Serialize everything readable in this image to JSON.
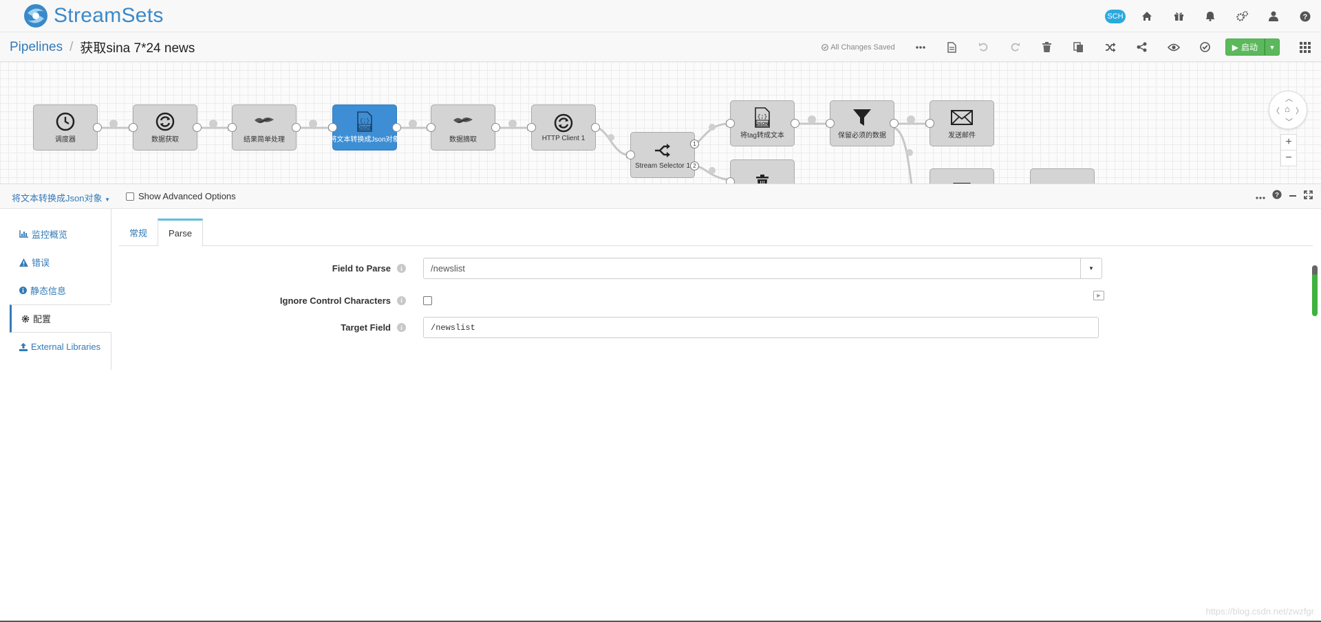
{
  "app": {
    "brand": "StreamSets",
    "sch_badge": "SCH"
  },
  "breadcrumb": {
    "root": "Pipelines",
    "separator": "/",
    "pipeline_name": "获取sina 7*24 news"
  },
  "toolbar": {
    "saved_status": "All Changes Saved",
    "start_label": "启动"
  },
  "pipeline": {
    "nodes": [
      {
        "id": "n1",
        "label": "调度器",
        "icon": "clock-icon"
      },
      {
        "id": "n2",
        "label": "数据获取",
        "icon": "refresh-icon"
      },
      {
        "id": "n3",
        "label": "结果简单处理",
        "icon": "groovy-icon"
      },
      {
        "id": "n4",
        "label": "将文本转换成Json对象",
        "icon": "json-icon",
        "selected": true
      },
      {
        "id": "n5",
        "label": "数据摘取",
        "icon": "groovy-icon"
      },
      {
        "id": "n6",
        "label": "HTTP Client 1",
        "icon": "refresh-icon"
      },
      {
        "id": "n7",
        "label": "Stream Selector 1",
        "icon": "shuffle-icon"
      },
      {
        "id": "n8",
        "label": "将tag转成文本",
        "icon": "json-icon"
      },
      {
        "id": "n9",
        "label": "保留必须的数据",
        "icon": "funnel-icon"
      },
      {
        "id": "n10",
        "label": "发送邮件",
        "icon": "envelope-icon"
      },
      {
        "id": "n11",
        "label": "",
        "icon": "trash-icon"
      },
      {
        "id": "n12",
        "label": "",
        "icon": "funnel-icon"
      },
      {
        "id": "n13",
        "label": "",
        "icon": "users-icon"
      }
    ],
    "output_ports": [
      "1",
      "2"
    ]
  },
  "detail": {
    "stage_name": "将文本转换成Json对象",
    "show_advanced_label": "Show Advanced Options",
    "nav": [
      {
        "label": "监控概览",
        "icon": "bar-chart-icon"
      },
      {
        "label": "错误",
        "icon": "warning-icon"
      },
      {
        "label": "静态信息",
        "icon": "info-icon"
      },
      {
        "label": "配置",
        "icon": "cog-icon",
        "active": true
      },
      {
        "label": "External Libraries",
        "icon": "upload-icon"
      }
    ],
    "tabs": [
      {
        "label": "常规"
      },
      {
        "label": "Parse",
        "active": true
      }
    ],
    "fields": {
      "field_to_parse": {
        "label": "Field to Parse",
        "value": "/newslist"
      },
      "ignore_control_chars": {
        "label": "Ignore Control Characters",
        "checked": false
      },
      "target_field": {
        "label": "Target Field",
        "value": "/newslist"
      }
    }
  },
  "watermark": "https://blog.csdn.net/zwzfgr",
  "colors": {
    "accent": "#337ab7",
    "selected_node": "#3d8ed4",
    "start_button": "#5cb85c",
    "brand": "#3a89c9"
  }
}
